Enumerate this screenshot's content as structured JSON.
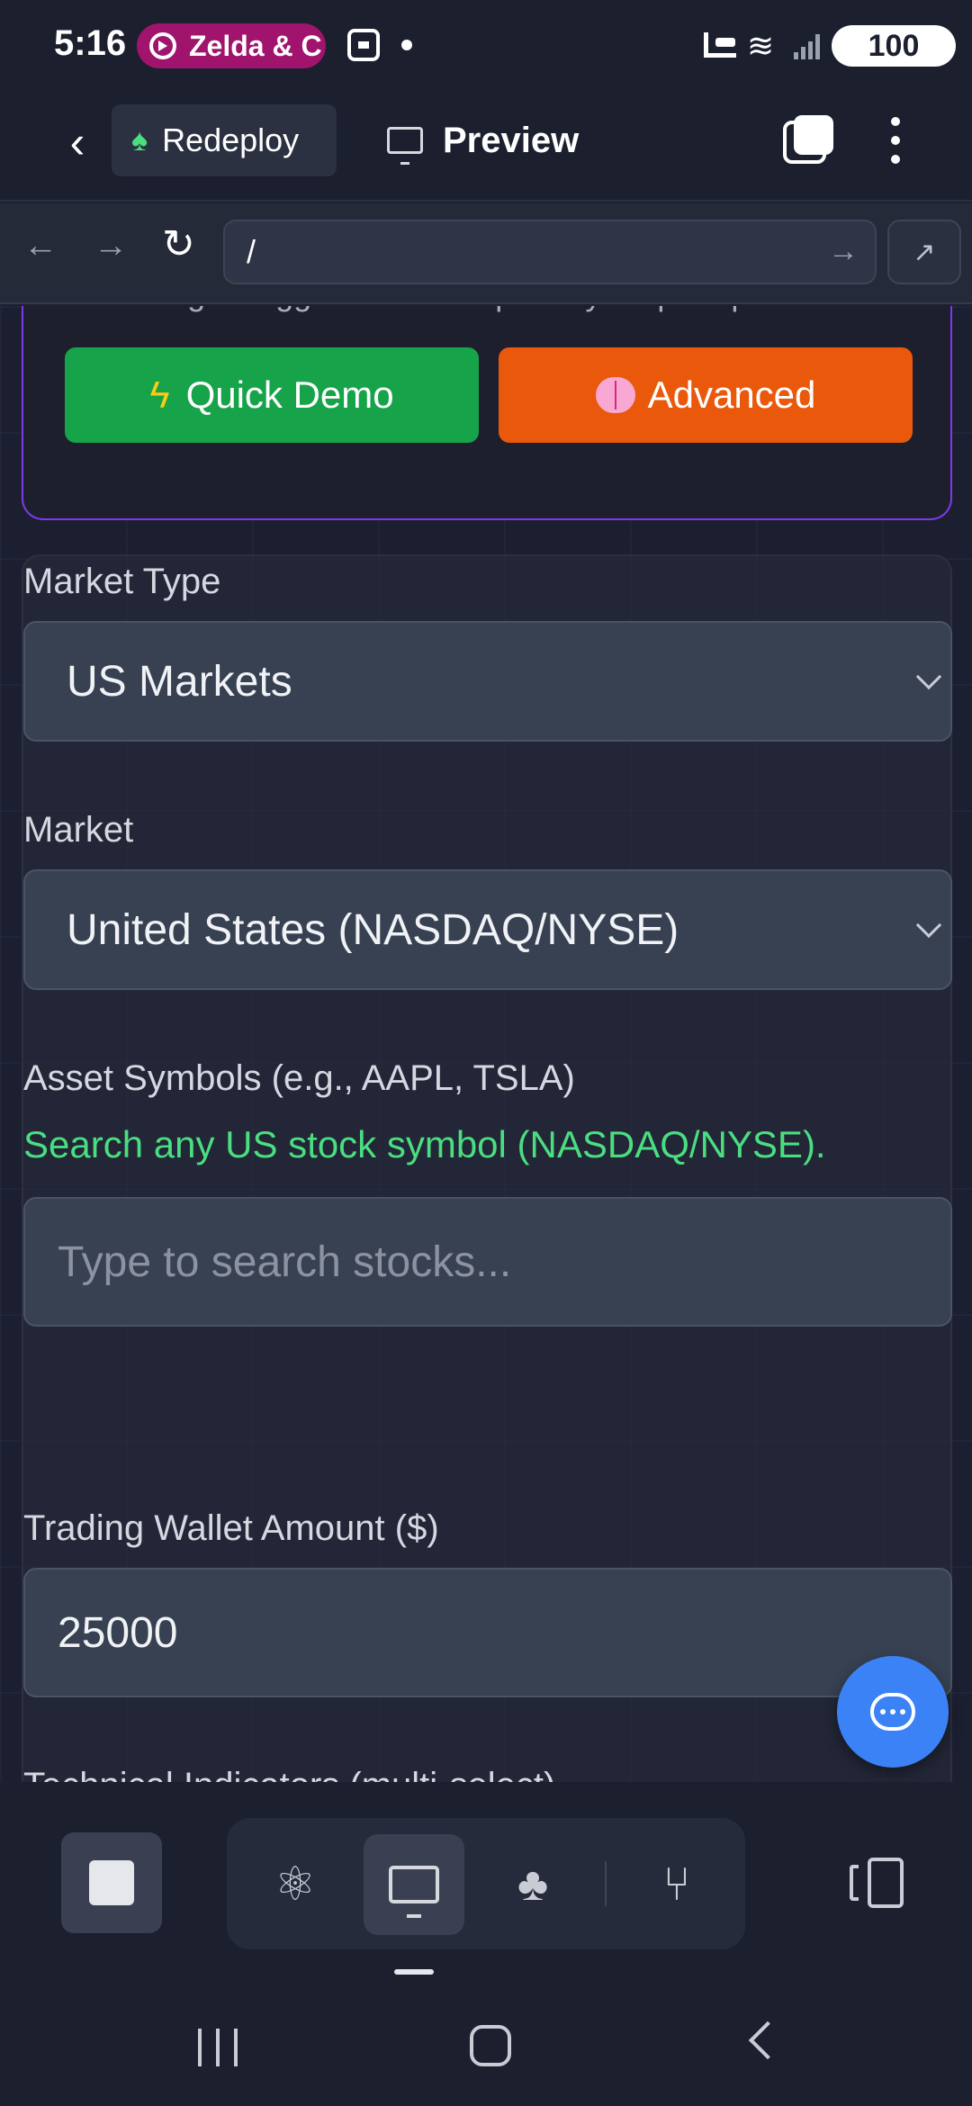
{
  "status_bar": {
    "time": "5:16",
    "notification": "Zelda & C",
    "battery": "100"
  },
  "header": {
    "redeploy_label": "Redeploy",
    "preview_label": "Preview"
  },
  "browser": {
    "url": "/"
  },
  "prompt_card": {
    "help_text": "wand to get suggestions or improve your prompt.",
    "quick_demo_label": "Quick Demo",
    "advanced_label": "Advanced"
  },
  "form": {
    "market_type_label": "Market Type",
    "market_type_value": "US Markets",
    "market_label": "Market",
    "market_value": "United States (NASDAQ/NYSE)",
    "asset_symbols_label": "Asset Symbols (e.g., AAPL, TSLA)",
    "asset_symbols_hint": "Search any US stock symbol (NASDAQ/NYSE).",
    "asset_search_placeholder": "Type to search stocks...",
    "wallet_label": "Trading Wallet Amount ($)",
    "wallet_value": "25000",
    "indicators_label": "Technical Indicators (multi-select)"
  },
  "colors": {
    "accent_green": "#16a34a",
    "accent_orange": "#ea580c",
    "hint_green": "#4ade80",
    "fab_blue": "#3b82f6",
    "card_border_purple": "#7c3aed"
  },
  "icons": {
    "quick_demo": "lightning-icon",
    "advanced": "brain-icon",
    "redeploy": "tree-icon",
    "chat": "chat-icon"
  }
}
